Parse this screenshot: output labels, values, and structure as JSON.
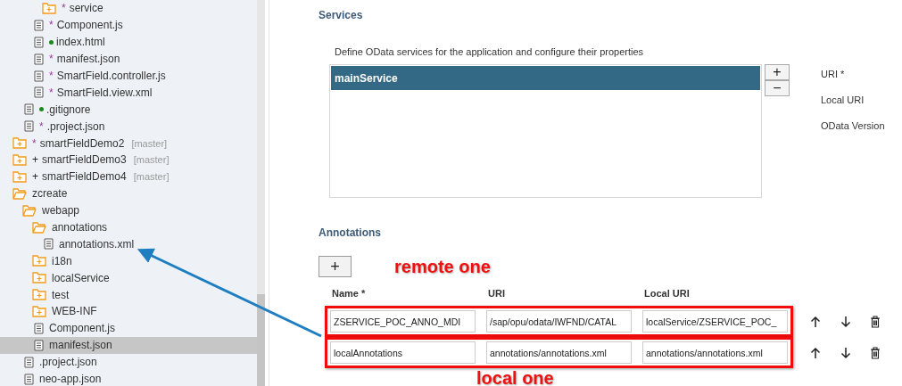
{
  "tree": [
    {
      "children": [
        {
          "children": [
            {
              "children": [
                {
                  "kind": "folder",
                  "label": "service",
                  "marker": "*",
                  "modified": true,
                  "selected": false
                }
              ]
            },
            {
              "kind": "file",
              "label": "Component.js",
              "marker": "*",
              "modified": true,
              "selected": false
            },
            {
              "kind": "file",
              "label": "index.html",
              "added": true,
              "selected": false
            },
            {
              "kind": "file",
              "label": "manifest.json",
              "marker": "*",
              "modified": true,
              "selected": false
            },
            {
              "kind": "file",
              "label": "SmartField.controller.js",
              "marker": "*",
              "modified": true,
              "selected": false
            },
            {
              "kind": "file",
              "label": "SmartField.view.xml",
              "marker": "*",
              "modified": true,
              "selected": false
            }
          ]
        },
        {
          "kind": "file",
          "label": ".gitignore",
          "added": true,
          "selected": false
        },
        {
          "kind": "file",
          "label": ".project.json",
          "marker": "*",
          "modified": true,
          "selected": false
        }
      ]
    },
    {
      "kind": "folder",
      "label": "smartFieldDemo2",
      "marker": "*",
      "modified": true,
      "branch": "[master]",
      "selected": false
    },
    {
      "kind": "folder",
      "label": "smartFieldDemo3",
      "marker": "+",
      "modified": false,
      "branch": "[master]",
      "selected": false
    },
    {
      "kind": "folder",
      "label": "smartFieldDemo4",
      "marker": "+",
      "modified": false,
      "branch": "[master]",
      "selected": false
    },
    {
      "kind": "open-folder",
      "label": "zcreate",
      "selected": false,
      "children": [
        {
          "kind": "open-folder",
          "label": "webapp",
          "selected": false,
          "children": [
            {
              "kind": "open-folder",
              "label": "annotations",
              "selected": false,
              "children": [
                {
                  "kind": "file",
                  "label": "annotations.xml",
                  "selected": false
                }
              ]
            },
            {
              "kind": "folder",
              "label": "i18n",
              "selected": false
            },
            {
              "kind": "folder",
              "label": "localService",
              "selected": false
            },
            {
              "kind": "folder",
              "label": "test",
              "selected": false
            },
            {
              "kind": "folder",
              "label": "WEB-INF",
              "selected": false
            },
            {
              "kind": "file",
              "label": "Component.js",
              "selected": false
            },
            {
              "kind": "file",
              "label": "manifest.json",
              "selected": true
            }
          ]
        },
        {
          "kind": "file",
          "label": ".project.json",
          "selected": false
        },
        {
          "kind": "file",
          "label": "neo-app.json",
          "selected": false
        }
      ]
    }
  ],
  "services": {
    "heading": "Services",
    "description": "Define OData services for the application and configure their properties",
    "items": [
      {
        "label": "mainService",
        "selected": true
      }
    ],
    "add_button": "+",
    "remove_button": "−",
    "properties": [
      "URI *",
      "Local URI",
      "OData Version"
    ]
  },
  "annotations": {
    "heading": "Annotations",
    "add_button": "+",
    "columns": [
      "Name *",
      "URI",
      "Local URI"
    ],
    "rows": [
      {
        "values": [
          "ZSERVICE_POC_ANNO_MDI",
          "/sap/opu/odata/IWFND/CATAL",
          "localService/ZSERVICE_POC_"
        ],
        "outlined": true
      },
      {
        "values": [
          "localAnnotations",
          "annotations/annotations.xml",
          "annotations/annotations.xml"
        ],
        "outlined": true
      }
    ]
  },
  "callouts": [
    "remote one",
    "local one"
  ]
}
